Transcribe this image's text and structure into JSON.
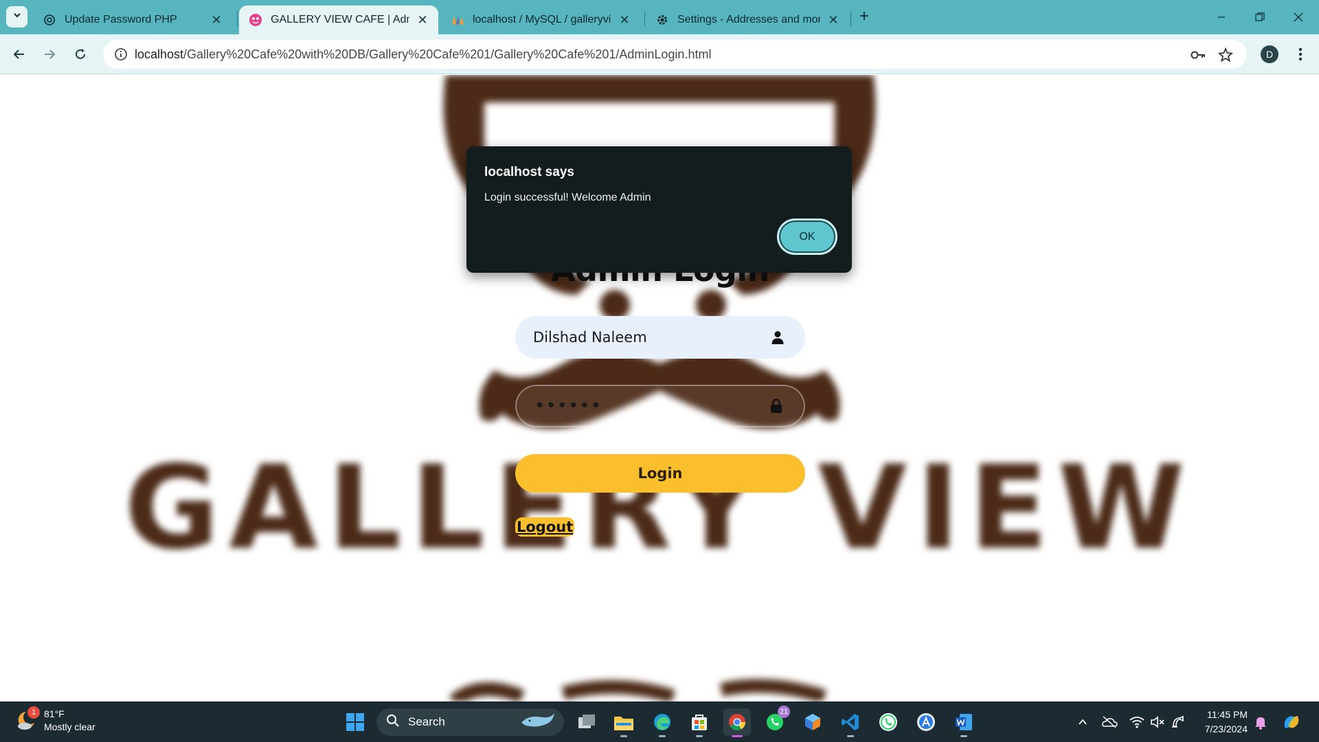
{
  "browser": {
    "tabs": [
      {
        "title": "Update Password PHP",
        "icon": "openai-icon",
        "active": false
      },
      {
        "title": "GALLERY VIEW CAFE | AdminLogin",
        "icon": "site-logo-icon",
        "active": true
      },
      {
        "title": "localhost / MySQL / galleryview",
        "icon": "phpmyadmin-icon",
        "active": false
      },
      {
        "title": "Settings - Addresses and more",
        "icon": "gear-icon",
        "active": false
      }
    ],
    "url_host": "localhost",
    "url_path": "/Gallery%20Cafe%20with%20DB/Gallery%20Cafe%201/Gallery%20Cafe%201/AdminLogin.html",
    "profile_initial": "D"
  },
  "page": {
    "background_text": "GALLERY VIEW",
    "title": "Admin Login",
    "username_value": "Dilshad Naleem",
    "password_mask": "••••••",
    "login_label": "Login",
    "logout_label": "Logout",
    "colors": {
      "accent": "#fbbf2d",
      "brand_brown": "#4b2a17",
      "input_bg": "#e8f0fe"
    }
  },
  "dialog": {
    "title": "localhost says",
    "message": "Login successful! Welcome Admin",
    "ok_label": "OK"
  },
  "taskbar": {
    "weather_temp": "81°F",
    "weather_desc": "Mostly clear",
    "weather_badge": "1",
    "search_label": "Search",
    "whatsapp_badge": "21",
    "time": "11:45 PM",
    "date": "7/23/2024"
  }
}
